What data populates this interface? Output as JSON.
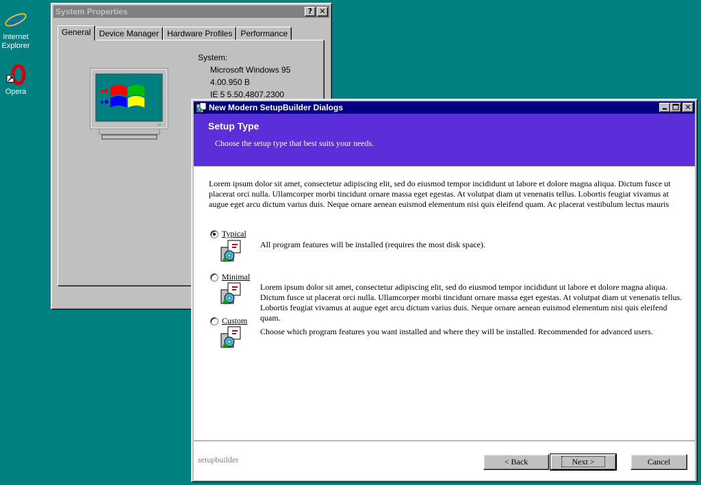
{
  "desktop": {
    "icons": [
      {
        "label_line1": "Internet",
        "label_line2": "Explorer",
        "icon": "internet-explorer-icon"
      },
      {
        "label": "Opera",
        "icon": "opera-icon"
      }
    ]
  },
  "system_properties": {
    "title": "System Properties",
    "tabs": [
      "General",
      "Device Manager",
      "Hardware Profiles",
      "Performance"
    ],
    "selected_tab": "General",
    "system_label": "System:",
    "system_lines": [
      "Microsoft Windows 95",
      "4.00.950 B",
      "IE 5 5.50.4807.2300"
    ]
  },
  "setup_dialog": {
    "title": "New Modern SetupBuilder Dialogs",
    "header_title": "Setup Type",
    "header_subtitle": "Choose the setup type that best suits your needs.",
    "intro": "Lorem ipsum dolor sit amet, consectetur adipiscing elit, sed do eiusmod tempor incididunt ut labore et dolore magna aliqua. Dictum fusce ut placerat orci nulla. Ullamcorper morbi tincidunt ornare massa eget egestas. At volutpat diam ut venenatis tellus. Lobortis feugiat vivamus at augue eget arcu dictum varius duis. Neque ornare aenean euismod elementum nisi quis eleifend quam. Ac placerat vestibulum lectus mauris",
    "options": [
      {
        "label": "Typical",
        "checked": true,
        "desc": "All program features will be installed (requires the most disk space)."
      },
      {
        "label": "Minimal",
        "checked": false,
        "desc": "Lorem ipsum dolor sit amet, consectetur adipiscing elit, sed do eiusmod tempor incididunt ut labore et dolore magna aliqua. Dictum fusce ut placerat orci nulla. Ullamcorper morbi tincidunt ornare massa eget egestas. At volutpat diam ut venenatis tellus. Lobortis feugiat vivamus at augue eget arcu dictum varius duis. Neque ornare aenean euismod elementum nisi quis eleifend quam."
      },
      {
        "label": "Custom",
        "checked": false,
        "desc": "Choose which program features you want installed and where they will be installed. Recommended for advanced users."
      }
    ],
    "brand": "setupbuilder",
    "buttons": {
      "back": "< Back",
      "next": "Next >",
      "cancel": "Cancel"
    }
  },
  "colors": {
    "desktop": "#008080",
    "title_active": "#000080",
    "title_inactive": "#808080",
    "header_band": "#5a2ed8"
  }
}
